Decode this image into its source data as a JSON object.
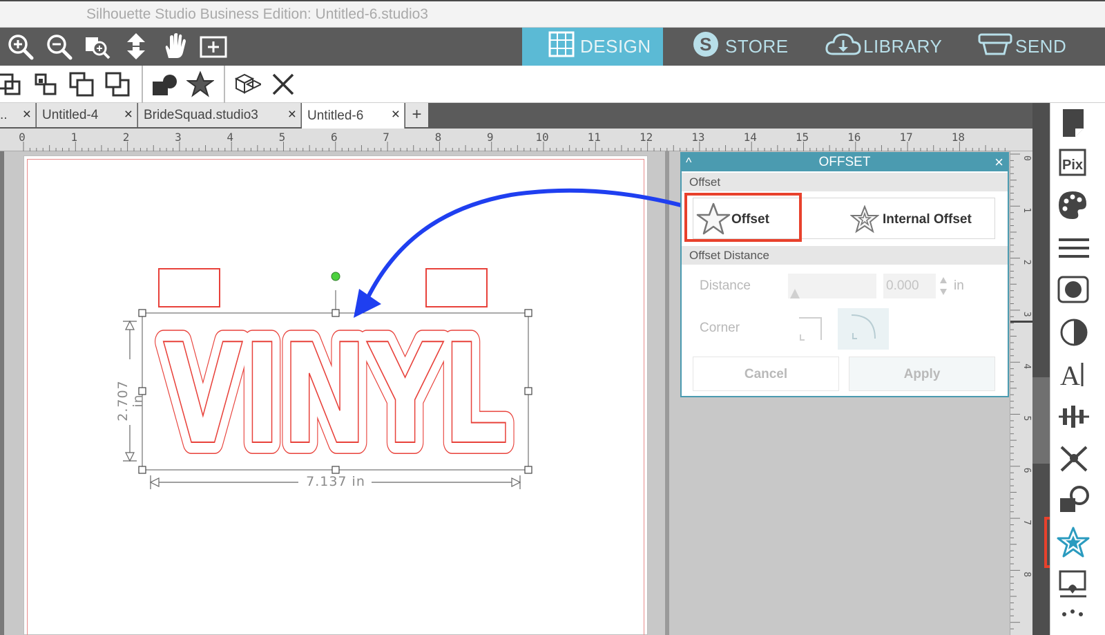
{
  "window": {
    "title": "Silhouette Studio Business Edition: Untitled-6.studio3"
  },
  "toolbar": {
    "tools": [
      "zoom-in-icon",
      "zoom-out-icon",
      "zoom-selection-icon",
      "pan-move-icon",
      "hand-icon",
      "fit-to-page-icon"
    ]
  },
  "nav": {
    "design": "DESIGN",
    "store": "STORE",
    "library": "LIBRARY",
    "send": "SEND",
    "active": "DESIGN",
    "active_color": "#5bbad5"
  },
  "doc_tabs": [
    {
      "label": "..",
      "active": false
    },
    {
      "label": "Untitled-4",
      "active": false
    },
    {
      "label": "BrideSquad.studio3",
      "active": false
    },
    {
      "label": "Untitled-6",
      "active": true
    }
  ],
  "ruler": {
    "h_numbers": [
      "0",
      "1",
      "2",
      "3",
      "4",
      "5",
      "6",
      "7",
      "8",
      "9",
      "10",
      "11",
      "12",
      "13",
      "14",
      "15",
      "16",
      "17",
      "18"
    ],
    "v_numbers": [
      "0",
      "1",
      "2",
      "3",
      "4",
      "5",
      "6",
      "7",
      "8"
    ]
  },
  "canvas": {
    "text": "VINYL",
    "height_label": "2.707 in",
    "width_label": "7.137 in",
    "outline_color": "#e8413a"
  },
  "offset_panel": {
    "title": "OFFSET",
    "section_offset": "Offset",
    "offset_option": "Offset",
    "internal_offset_option": "Internal Offset",
    "section_distance": "Offset Distance",
    "distance_label": "Distance",
    "distance_value": "0.000",
    "distance_unit": "in",
    "corner_label": "Corner",
    "cancel": "Cancel",
    "apply": "Apply",
    "accent": "#4b9bb0"
  },
  "highlight_color": "#e8412c",
  "arrow_color": "#1f3ff0"
}
